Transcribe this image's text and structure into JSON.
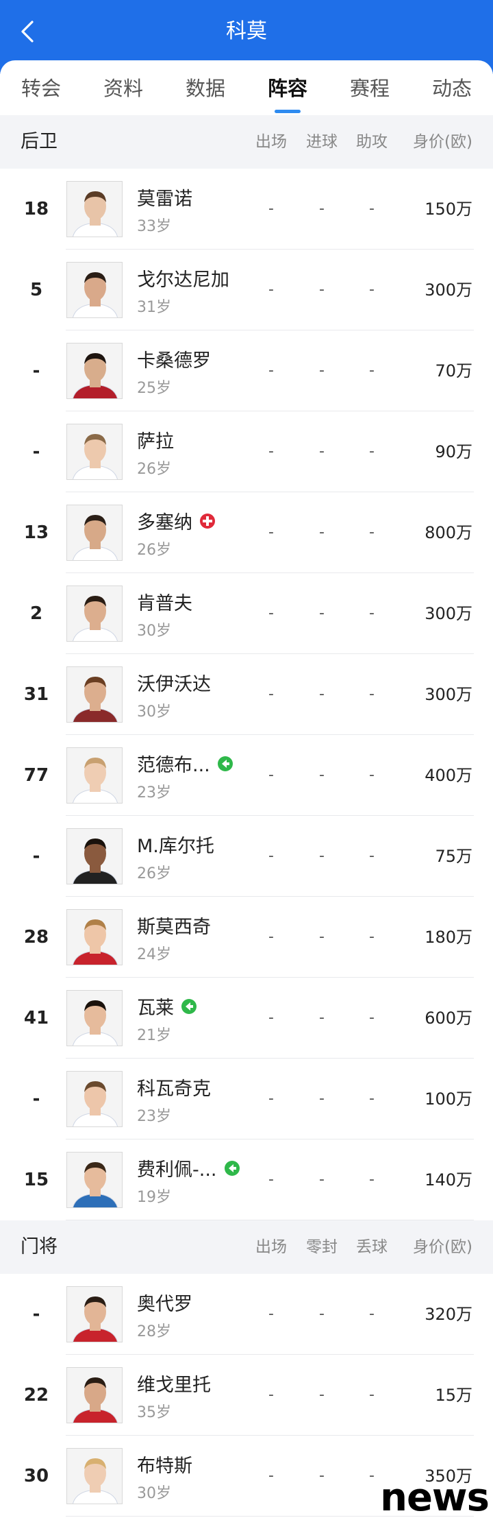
{
  "header": {
    "title": "科莫"
  },
  "tabs": [
    {
      "label": "转会",
      "active": false
    },
    {
      "label": "资料",
      "active": false
    },
    {
      "label": "数据",
      "active": false
    },
    {
      "label": "阵容",
      "active": true
    },
    {
      "label": "赛程",
      "active": false
    },
    {
      "label": "动态",
      "active": false
    }
  ],
  "sections": [
    {
      "title": "后卫",
      "columns": [
        "出场",
        "进球",
        "助攻",
        "身价(欧)"
      ],
      "players": [
        {
          "number": "18",
          "name": "莫雷诺",
          "age": "33岁",
          "stats": [
            "-",
            "-",
            "-"
          ],
          "value": "150万",
          "badge": null,
          "kit": "#ffffff",
          "skin": "#e8c4a8",
          "hair": "#5a3c26"
        },
        {
          "number": "5",
          "name": "戈尔达尼加",
          "age": "31岁",
          "stats": [
            "-",
            "-",
            "-"
          ],
          "value": "300万",
          "badge": null,
          "kit": "#ffffff",
          "skin": "#d9a98a",
          "hair": "#2a1e16"
        },
        {
          "number": "-",
          "name": "卡桑德罗",
          "age": "25岁",
          "stats": [
            "-",
            "-",
            "-"
          ],
          "value": "70万",
          "badge": null,
          "kit": "#b31e2a",
          "skin": "#d8ad8c",
          "hair": "#1e1510"
        },
        {
          "number": "-",
          "name": "萨拉",
          "age": "26岁",
          "stats": [
            "-",
            "-",
            "-"
          ],
          "value": "90万",
          "badge": null,
          "kit": "#ffffff",
          "skin": "#edc9ad",
          "hair": "#8a6a48"
        },
        {
          "number": "13",
          "name": "多塞纳",
          "age": "26岁",
          "stats": [
            "-",
            "-",
            "-"
          ],
          "value": "800万",
          "badge": "injury",
          "kit": "#ffffff",
          "skin": "#d7a988",
          "hair": "#2b1f17"
        },
        {
          "number": "2",
          "name": "肯普夫",
          "age": "30岁",
          "stats": [
            "-",
            "-",
            "-"
          ],
          "value": "300万",
          "badge": null,
          "kit": "#ffffff",
          "skin": "#dcae8e",
          "hair": "#2a1d14"
        },
        {
          "number": "31",
          "name": "沃伊沃达",
          "age": "30岁",
          "stats": [
            "-",
            "-",
            "-"
          ],
          "value": "300万",
          "badge": null,
          "kit": "#8a2a2a",
          "skin": "#dcae8e",
          "hair": "#6a3e22"
        },
        {
          "number": "77",
          "name": "范德布...",
          "age": "23岁",
          "stats": [
            "-",
            "-",
            "-"
          ],
          "value": "400万",
          "badge": "loan",
          "kit": "#ffffff",
          "skin": "#efcdb3",
          "hair": "#c8a070"
        },
        {
          "number": "-",
          "name": "M.库尔托",
          "age": "26岁",
          "stats": [
            "-",
            "-",
            "-"
          ],
          "value": "75万",
          "badge": null,
          "kit": "#222222",
          "skin": "#8a5a3e",
          "hair": "#1a120c"
        },
        {
          "number": "28",
          "name": "斯莫西奇",
          "age": "24岁",
          "stats": [
            "-",
            "-",
            "-"
          ],
          "value": "180万",
          "badge": null,
          "kit": "#c8232c",
          "skin": "#eec6a8",
          "hair": "#b08048"
        },
        {
          "number": "41",
          "name": "瓦莱",
          "age": "21岁",
          "stats": [
            "-",
            "-",
            "-"
          ],
          "value": "600万",
          "badge": "loan",
          "kit": "#ffffff",
          "skin": "#e6bb9c",
          "hair": "#1a120c"
        },
        {
          "number": "-",
          "name": "科瓦奇克",
          "age": "23岁",
          "stats": [
            "-",
            "-",
            "-"
          ],
          "value": "100万",
          "badge": null,
          "kit": "#ffffff",
          "skin": "#edc6aa",
          "hair": "#6a4a2e"
        },
        {
          "number": "15",
          "name": "费利佩-...",
          "age": "19岁",
          "stats": [
            "-",
            "-",
            "-"
          ],
          "value": "140万",
          "badge": "loan",
          "kit": "#2d6fb8",
          "skin": "#e6bb9c",
          "hair": "#3a2818"
        }
      ]
    },
    {
      "title": "门将",
      "columns": [
        "出场",
        "零封",
        "丢球",
        "身价(欧)"
      ],
      "players": [
        {
          "number": "-",
          "name": "奥代罗",
          "age": "28岁",
          "stats": [
            "-",
            "-",
            "-"
          ],
          "value": "320万",
          "badge": null,
          "kit": "#c8232c",
          "skin": "#e2b596",
          "hair": "#2a1d14"
        },
        {
          "number": "22",
          "name": "维戈里托",
          "age": "35岁",
          "stats": [
            "-",
            "-",
            "-"
          ],
          "value": "15万",
          "badge": null,
          "kit": "#c8232c",
          "skin": "#d8a888",
          "hair": "#2a1d14"
        },
        {
          "number": "30",
          "name": "布特斯",
          "age": "30岁",
          "stats": [
            "-",
            "-",
            "-"
          ],
          "value": "350万",
          "badge": null,
          "kit": "#ffffff",
          "skin": "#efcdb3",
          "hair": "#d8b070"
        }
      ]
    }
  ],
  "watermark": "news",
  "colors": {
    "primary": "#1f6fe8",
    "accent": "#2e8bf0",
    "injury": "#e02a3a",
    "loan": "#2fb84a"
  }
}
